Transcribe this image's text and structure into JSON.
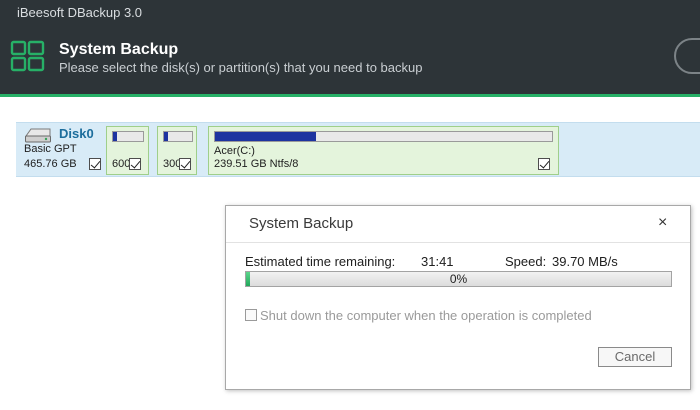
{
  "app": {
    "title": "iBeesoft DBackup 3.0"
  },
  "header": {
    "title": "System Backup",
    "subtitle": "Please select the disk(s) or partition(s) that you need to backup",
    "logo_icon": "windows-logo-icon",
    "accent_color": "#27b067"
  },
  "disk": {
    "name": "Disk0",
    "type": "Basic GPT",
    "size": "465.76 GB",
    "checked": true,
    "partitions": [
      {
        "label": "",
        "info": "600",
        "used_fraction": 0.12,
        "checked": true
      },
      {
        "label": "",
        "info": "300",
        "used_fraction": 0.15,
        "checked": true
      },
      {
        "label": "Acer(C:)",
        "info": "239.51 GB Ntfs/8",
        "used_fraction": 0.3,
        "checked": true
      }
    ]
  },
  "dialog": {
    "title": "System Backup",
    "close_label": "×",
    "estimated_label": "Estimated time remaining:",
    "estimated_value": "31:41",
    "speed_label": "Speed:",
    "speed_value": "39.70 MB/s",
    "progress_text": "0%",
    "progress_fraction": 0.01,
    "shutdown_label": "Shut down the computer when the operation is completed",
    "shutdown_checked": false,
    "cancel_label": "Cancel"
  }
}
